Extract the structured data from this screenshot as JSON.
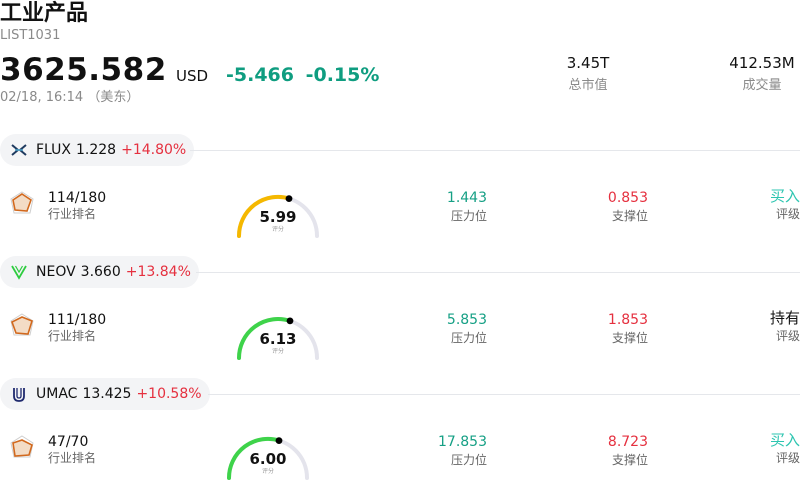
{
  "header": {
    "title": "工业产品",
    "code": "LIST1031",
    "price": "3625.582",
    "currency": "USD",
    "change": "-5.466",
    "change_pct": "-0.15%",
    "time": "02/18, 16:14 （美东）",
    "market_cap": {
      "value": "3.45T",
      "label": "总市值"
    },
    "volume": {
      "value": "412.53M",
      "label": "成交量"
    }
  },
  "colors": {
    "down": "#0f9d80",
    "up": "#e5303f",
    "buy": "#2cc5b0"
  },
  "stocks": [
    {
      "symbol": "FLUX",
      "price": "1.228",
      "change_pct": "+14.80%",
      "icon": "flux-logo-icon",
      "rank": "114/180",
      "rank_label": "行业排名",
      "score": "5.99",
      "score_label": "评分",
      "score_fraction": 0.6,
      "gauge_color": "#f5b800",
      "resistance": "1.443",
      "resistance_label": "压力位",
      "support": "0.853",
      "support_label": "支撑位",
      "rating": "买入",
      "rating_label": "评级"
    },
    {
      "symbol": "NEOV",
      "price": "3.660",
      "change_pct": "+13.84%",
      "icon": "neov-logo-icon",
      "rank": "111/180",
      "rank_label": "行业排名",
      "score": "6.13",
      "score_label": "评分",
      "score_fraction": 0.61,
      "gauge_color": "#3ed34a",
      "resistance": "5.853",
      "resistance_label": "压力位",
      "support": "1.853",
      "support_label": "支撑位",
      "rating": "持有",
      "rating_label": "评级"
    },
    {
      "symbol": "UMAC",
      "price": "13.425",
      "change_pct": "+10.58%",
      "icon": "umac-logo-icon",
      "rank": "47/70",
      "rank_label": "行业排名",
      "score": "6.00",
      "score_label": "评分",
      "score_fraction": 0.6,
      "gauge_color": "#3ed34a",
      "resistance": "17.853",
      "resistance_label": "压力位",
      "support": "8.723",
      "support_label": "支撑位",
      "rating": "买入",
      "rating_label": "评级"
    }
  ]
}
